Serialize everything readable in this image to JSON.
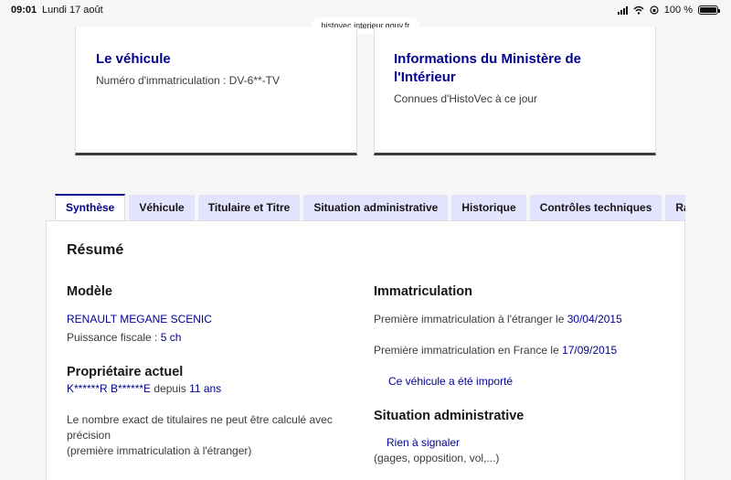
{
  "status_bar": {
    "time": "09:01",
    "date": "Lundi 17 août",
    "battery": "100 %"
  },
  "browser": {
    "url": "histovec.interieur.gouv.fr"
  },
  "cards": {
    "vehicle": {
      "title": "Le véhicule",
      "text": "Numéro d'immatriculation : DV-6**-TV"
    },
    "ministry": {
      "title": "Informations du Ministère de l'Intérieur",
      "text": "Connues d'HistoVec à ce jour"
    }
  },
  "tabs": [
    {
      "label": "Synthèse",
      "active": true
    },
    {
      "label": "Véhicule",
      "active": false
    },
    {
      "label": "Titulaire et Titre",
      "active": false
    },
    {
      "label": "Situation administrative",
      "active": false
    },
    {
      "label": "Historique",
      "active": false
    },
    {
      "label": "Contrôles techniques",
      "active": false
    },
    {
      "label": "Rap",
      "active": false
    }
  ],
  "summary": {
    "title": "Résumé",
    "model": {
      "heading": "Modèle",
      "name": "RENAULT MEGANE SCENIC",
      "power_label": "Puissance fiscale : ",
      "power_value": "5 ch"
    },
    "owner": {
      "heading": "Propriétaire actuel",
      "name": "K******R B******E",
      "since_label": " depuis ",
      "since_value": "11 ans",
      "note_line1": "Le nombre exact de titulaires ne peut être calculé avec précision",
      "note_line2": "(première immatriculation à l'étranger)"
    },
    "registration": {
      "heading": "Immatriculation",
      "foreign_label": "Première immatriculation à l'étranger le ",
      "foreign_date": "30/04/2015",
      "france_label": "Première immatriculation en France le ",
      "france_date": "17/09/2015",
      "imported": "Ce véhicule a été importé"
    },
    "admin": {
      "heading": "Situation administrative",
      "status": "Rien à signaler",
      "detail": "(gages, opposition, vol,...)"
    }
  },
  "colors": {
    "primary_blue": "#000091",
    "tab_inactive": "#e3e3fd"
  }
}
